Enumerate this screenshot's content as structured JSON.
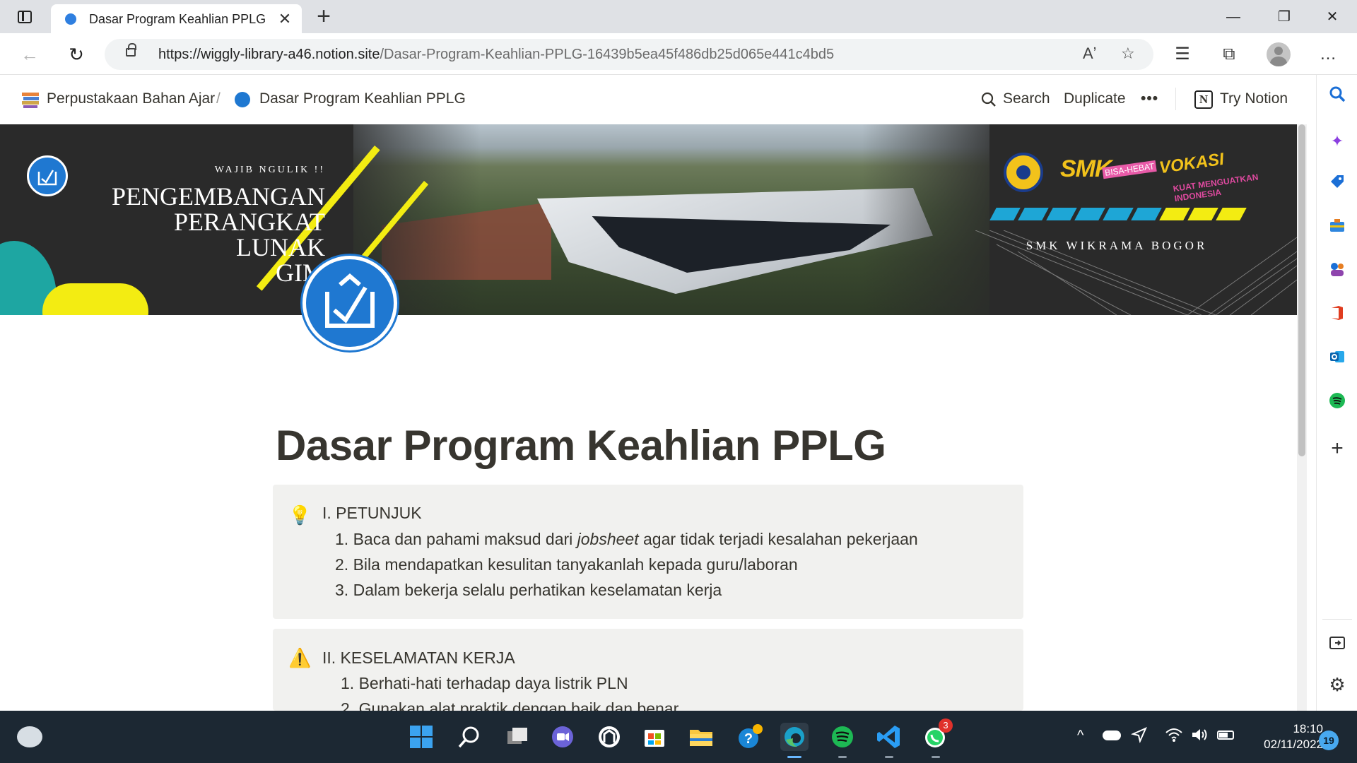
{
  "browser": {
    "tab_title": "Dasar Program Keahlian PPLG",
    "url_domain": "https://wiggly-library-a46.notion.site",
    "url_path": "/Dasar-Program-Keahlian-PPLG-16439b5ea45f486db25d065e441c4bd5",
    "read_aloud_label": "Aʼ",
    "icons": {
      "tab_actions": "tab-actions-icon",
      "new_tab": "+",
      "minimize": "—",
      "restore": "❐",
      "close": "✕",
      "back": "←",
      "refresh": "↻",
      "favorite_add": "☆",
      "favorites": "☰",
      "collections": "⧉",
      "more": "…"
    }
  },
  "notion": {
    "breadcrumb": [
      "Perpustakaan Bahan Ajar",
      "Dasar Program Keahlian PPLG"
    ],
    "breadcrumb_sep": "/",
    "search_label": "Search",
    "duplicate_label": "Duplicate",
    "more_label": "•••",
    "try_notion_label": "Try Notion",
    "notion_logo_letter": "N",
    "cover": {
      "kicker": "WAJIB NGULIK !!",
      "title": "PENGEMBANGAN\nPERANGKAT\nLUNAK\nGIM",
      "school_name": "SMK WIKRAMA BOGOR",
      "smk_brand": "SMK",
      "smk_tag": "BISA-HEBAT",
      "vokasi_brand": "VOKASI",
      "vokasi_sub": "KUAT MENGUATKAN INDONESIA"
    },
    "page_title": "Dasar Program Keahlian PPLG",
    "callouts": [
      {
        "icon": "lightbulb-icon",
        "emoji": "💡",
        "heading": "I. PETUNJUK",
        "items": [
          {
            "num": "1.",
            "before": "Baca dan pahami maksud dari ",
            "italic": "jobsheet",
            "after": " agar tidak terjadi kesalahan pekerjaan"
          },
          {
            "num": "2.",
            "text": "Bila mendapatkan kesulitan tanyakanlah kepada guru/laboran"
          },
          {
            "num": "3.",
            "text": "Dalam bekerja selalu perhatikan keselamatan kerja"
          }
        ]
      },
      {
        "icon": "warning-icon",
        "emoji": "⚠️",
        "heading": "II. KESELAMATAN KERJA",
        "items": [
          {
            "num": "1.",
            "text": "Berhati-hati terhadap daya listrik PLN"
          },
          {
            "num": "2.",
            "text": "Gunakan alat praktik dengan baik dan benar"
          }
        ]
      }
    ]
  },
  "edge_sidebar": {
    "items": [
      "search",
      "copilot",
      "shopping",
      "tools",
      "games",
      "office",
      "outlook",
      "spotify"
    ],
    "add_label": "+"
  },
  "taskbar": {
    "time": "18:10",
    "date": "02/11/2022",
    "notification_count": "19",
    "whatsapp_badge": "3",
    "tray_chevron": "^"
  },
  "colors": {
    "notion_text": "#37352f",
    "callout_bg": "#f1f1ef",
    "brand_blue": "#1f78d1",
    "accent_yellow": "#f3ec12",
    "taskbar_bg": "#1c2833"
  }
}
